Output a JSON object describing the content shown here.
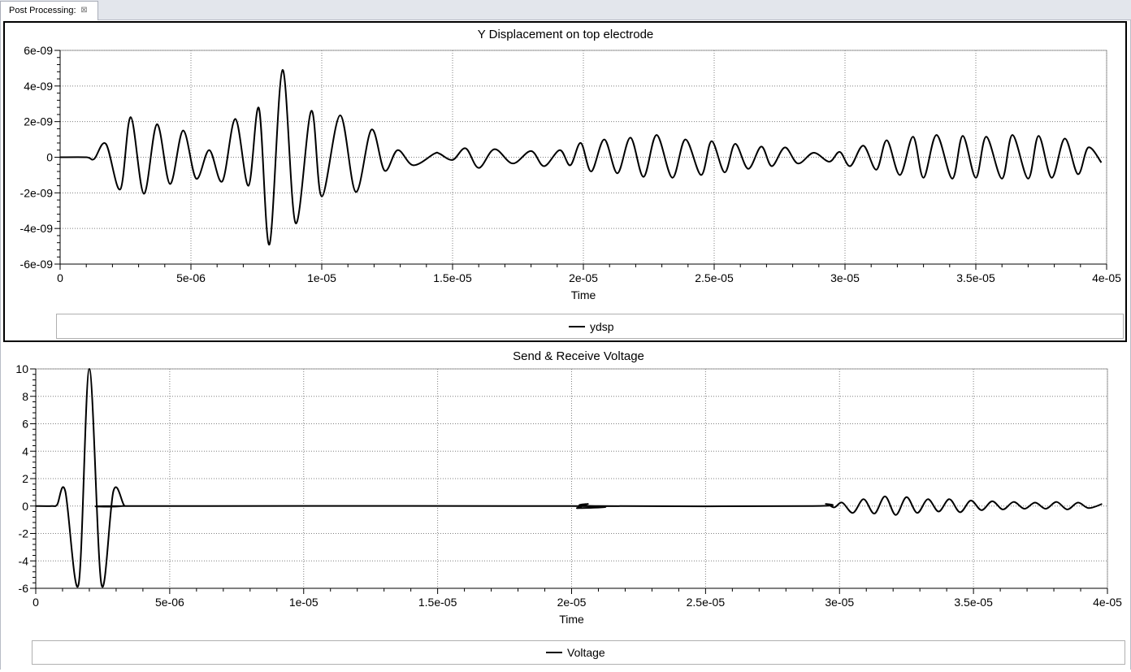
{
  "tab": {
    "label": "Post Processing:",
    "close_glyph": "⊠"
  },
  "colors": {
    "line": "#000000",
    "grid": "#7f7f7f",
    "tab_bg": "#e3e6ec"
  },
  "chart_data": [
    {
      "type": "line",
      "title": "Y Displacement on top electrode",
      "xlabel": "Time",
      "ylabel": "",
      "xlim": [
        0,
        4e-05
      ],
      "ylim": [
        -6e-09,
        6e-09
      ],
      "x_ticks": [
        0,
        5e-06,
        1e-05,
        1.5e-05,
        2e-05,
        2.5e-05,
        3e-05,
        3.5e-05,
        4e-05
      ],
      "x_tick_labels": [
        "0",
        "5e-06",
        "1e-05",
        "1.5e-05",
        "2e-05",
        "2.5e-05",
        "3e-05",
        "3.5e-05",
        "4e-05"
      ],
      "y_ticks": [
        6e-09,
        4e-09,
        2e-09,
        0,
        -2e-09,
        -4e-09,
        -6e-09
      ],
      "y_tick_labels": [
        "6e-09",
        "4e-09",
        "2e-09",
        "0",
        "-2e-09",
        "-4e-09",
        "-6e-09"
      ],
      "grid": true,
      "legend": "bottom-center",
      "series": [
        {
          "name": "ydsp",
          "x": [
            0,
            1e-06,
            1.3e-06,
            1.75e-06,
            2.3e-06,
            2.7e-06,
            3.2e-06,
            3.7e-06,
            4.2e-06,
            4.7e-06,
            5.2e-06,
            5.7e-06,
            6.2e-06,
            6.7e-06,
            7.2e-06,
            7.6e-06,
            8e-06,
            8.5e-06,
            9e-06,
            9.6e-06,
            1e-05,
            1.07e-05,
            1.13e-05,
            1.19e-05,
            1.24e-05,
            1.29e-05,
            1.35e-05,
            1.43e-05,
            1.45e-05,
            1.5e-05,
            1.55e-05,
            1.6e-05,
            1.66e-05,
            1.73e-05,
            1.8e-05,
            1.85e-05,
            1.91e-05,
            1.95e-05,
            1.99e-05,
            2.03e-05,
            2.08e-05,
            2.13e-05,
            2.18e-05,
            2.23e-05,
            2.28e-05,
            2.34e-05,
            2.39e-05,
            2.45e-05,
            2.49e-05,
            2.54e-05,
            2.58e-05,
            2.63e-05,
            2.68e-05,
            2.72e-05,
            2.77e-05,
            2.82e-05,
            2.88e-05,
            2.94e-05,
            2.98e-05,
            3.02e-05,
            3.07e-05,
            3.12e-05,
            3.16e-05,
            3.21e-05,
            3.26e-05,
            3.3e-05,
            3.35e-05,
            3.41e-05,
            3.45e-05,
            3.5e-05,
            3.54e-05,
            3.6e-05,
            3.64e-05,
            3.7e-05,
            3.74e-05,
            3.79e-05,
            3.84e-05,
            3.89e-05,
            3.93e-05,
            3.98e-05
          ],
          "y": [
            0,
            0,
            -1e-10,
            7.5e-10,
            -1.8e-09,
            2.25e-09,
            -2.05e-09,
            1.85e-09,
            -1.5e-09,
            1.5e-09,
            -1.2e-09,
            4e-10,
            -1.35e-09,
            2.15e-09,
            -1.6e-09,
            2.75e-09,
            -4.9e-09,
            4.9e-09,
            -3.7e-09,
            2.6e-09,
            -2.2e-09,
            2.35e-09,
            -1.95e-09,
            1.55e-09,
            -7.5e-10,
            4e-10,
            -4.5e-10,
            2e-10,
            2e-10,
            -1.5e-10,
            5e-10,
            -6e-10,
            4.5e-10,
            -3.5e-10,
            3.5e-10,
            -5e-10,
            4e-10,
            -4.5e-10,
            8e-10,
            -8e-10,
            1e-09,
            -9e-10,
            1.1e-09,
            -1.1e-09,
            1.25e-09,
            -1.15e-09,
            1e-09,
            -1e-09,
            9e-10,
            -8.5e-10,
            7.5e-10,
            -6.5e-10,
            6e-10,
            -5e-10,
            5.5e-10,
            -3.5e-10,
            2.5e-10,
            -2.5e-10,
            3e-10,
            -5e-10,
            6.5e-10,
            -7e-10,
            9.5e-10,
            -1e-09,
            1.15e-09,
            -1.15e-09,
            1.25e-09,
            -1.2e-09,
            1.2e-09,
            -1.15e-09,
            1.15e-09,
            -1.2e-09,
            1.25e-09,
            -1.2e-09,
            1.2e-09,
            -1.15e-09,
            1.05e-09,
            -9.5e-10,
            5.5e-10,
            -3e-10
          ]
        }
      ]
    },
    {
      "type": "line",
      "title": "Send & Receive Voltage",
      "xlabel": "Time",
      "ylabel": "",
      "xlim": [
        0,
        4e-05
      ],
      "ylim": [
        -6,
        10
      ],
      "x_ticks": [
        0,
        5e-06,
        1e-05,
        1.5e-05,
        2e-05,
        2.5e-05,
        3e-05,
        3.5e-05,
        4e-05
      ],
      "x_tick_labels": [
        "0",
        "5e-06",
        "1e-05",
        "1.5e-05",
        "2e-05",
        "2.5e-05",
        "3e-05",
        "3.5e-05",
        "4e-05"
      ],
      "y_ticks": [
        10,
        8,
        6,
        4,
        2,
        0,
        -2,
        -4,
        -6
      ],
      "y_tick_labels": [
        "10",
        "8",
        "6",
        "4",
        "2",
        "0",
        "-2",
        "-4",
        "-6"
      ],
      "grid": true,
      "legend": "bottom-center",
      "series": [
        {
          "name": "Voltage",
          "x": [
            0,
            6e-07,
            8e-07,
            1.1e-06,
            1.6e-06,
            2e-06,
            2.45e-06,
            2.9e-06,
            3.3e-06,
            3.5e-06,
            2e-05,
            2.02e-05,
            2.06e-05,
            2.1e-05,
            2.9e-05,
            2.95e-05,
            2.98e-05,
            3.01e-05,
            3.05e-05,
            3.09e-05,
            3.13e-05,
            3.17e-05,
            3.21e-05,
            3.25e-05,
            3.29e-05,
            3.33e-05,
            3.37e-05,
            3.41e-05,
            3.45e-05,
            3.49e-05,
            3.53e-05,
            3.57e-05,
            3.61e-05,
            3.65e-05,
            3.69e-05,
            3.73e-05,
            3.77e-05,
            3.81e-05,
            3.85e-05,
            3.89e-05,
            3.93e-05,
            3.98e-05
          ],
          "y": [
            0,
            0,
            0.1,
            1.1,
            -5.7,
            10.0,
            -5.7,
            1.1,
            0.05,
            0,
            0,
            -0.15,
            0.15,
            0,
            0,
            0.15,
            -0.1,
            0.25,
            -0.5,
            0.5,
            -0.55,
            0.7,
            -0.65,
            0.65,
            -0.5,
            0.5,
            -0.4,
            0.5,
            -0.45,
            0.4,
            -0.3,
            0.35,
            -0.25,
            0.3,
            -0.2,
            0.25,
            -0.2,
            0.3,
            -0.25,
            0.25,
            -0.15,
            0.15
          ]
        }
      ]
    }
  ]
}
